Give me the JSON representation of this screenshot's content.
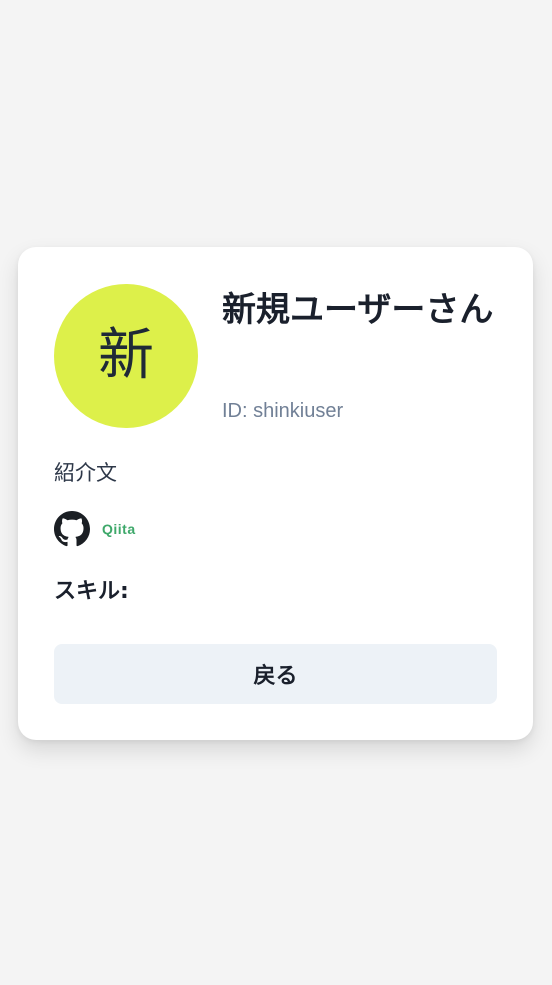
{
  "profile": {
    "avatar_initial": "新",
    "name": "新規ユーザーさん",
    "id_text": "ID: shinkiuser",
    "bio": "紹介文",
    "avatar_color": "#ddf04a"
  },
  "links": {
    "github_icon": "github-icon",
    "qiita_label": "Qiita"
  },
  "skills": {
    "label": "スキル:"
  },
  "actions": {
    "back_label": "戻る"
  }
}
